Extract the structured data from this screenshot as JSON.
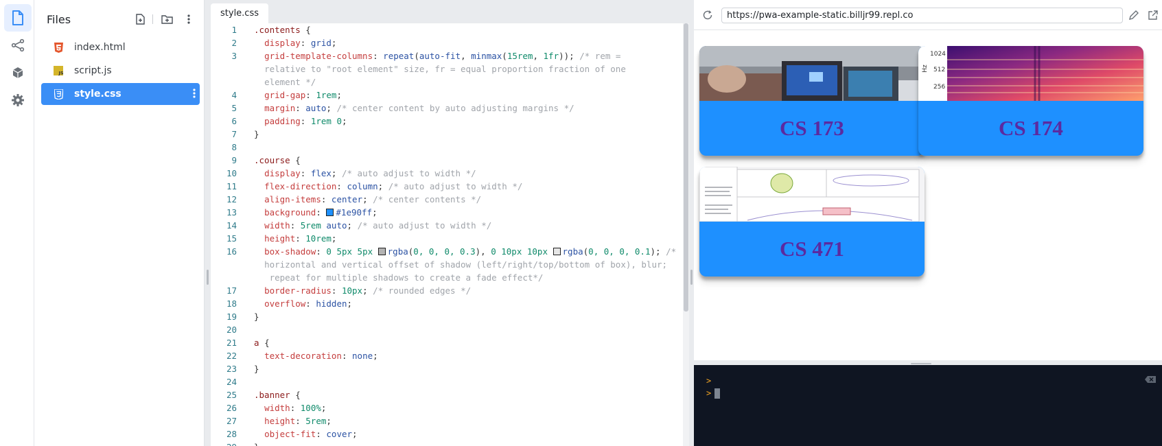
{
  "files_panel": {
    "title": "Files",
    "items": [
      {
        "label": "index.html",
        "icon": "html5-icon"
      },
      {
        "label": "script.js",
        "icon": "js-icon"
      },
      {
        "label": "style.css",
        "icon": "css3-icon",
        "active": true
      }
    ]
  },
  "editor": {
    "tab": "style.css"
  },
  "preview": {
    "url": "https://pwa-example-static.billjr99.repl.co",
    "cards": [
      {
        "title": "CS 173"
      },
      {
        "title": "CS 174"
      },
      {
        "title": "CS 471"
      }
    ],
    "spectrogram_labels": [
      "1024",
      "512",
      "256"
    ],
    "spectrogram_unit": "Hz"
  },
  "colors": {
    "accent": "#3a8ef6",
    "card_bg": "#1e90ff",
    "card_title": "#5b2aa0",
    "console_bg": "#0f1522",
    "prompt": "#f5a623"
  },
  "console": {
    "prompt_symbol": ">"
  }
}
